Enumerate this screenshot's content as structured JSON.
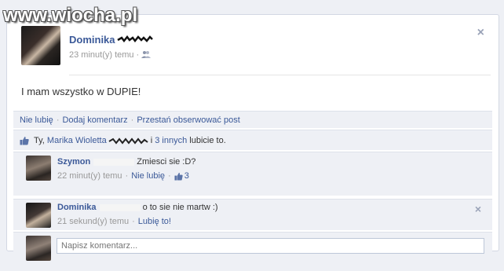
{
  "watermark": "www.wiocha.pl",
  "post": {
    "author": "Dominika",
    "time": "23 minut(y) temu",
    "status": "I mam wszystko w DUPIE!",
    "close": "×"
  },
  "actions": {
    "unlike": "Nie lubię",
    "comment": "Dodaj komentarz",
    "unfollow": "Przestań obserwować post"
  },
  "likes": {
    "you": "Ty,",
    "person": "Marika Wioletta",
    "and": "i",
    "others": "3 innych",
    "suffix": "lubicie to."
  },
  "comments": [
    {
      "author": "Szymon",
      "text": "Zmiesci sie :D?",
      "time": "22 minut(y) temu",
      "action": "Nie lubię",
      "like_count": "3"
    },
    {
      "author": "Dominika",
      "text": "o to sie nie martw :)",
      "time": "21 sekund(y) temu",
      "action": "Lubię to!",
      "close": "×"
    }
  ],
  "input": {
    "placeholder": "Napisz komentarz..."
  },
  "icons": {
    "friends": "friends-icon",
    "thumb": "thumbs-up-icon",
    "close": "close-icon"
  },
  "colors": {
    "link": "#3b5998",
    "background": "#eef0f5",
    "meta": "#999999"
  }
}
